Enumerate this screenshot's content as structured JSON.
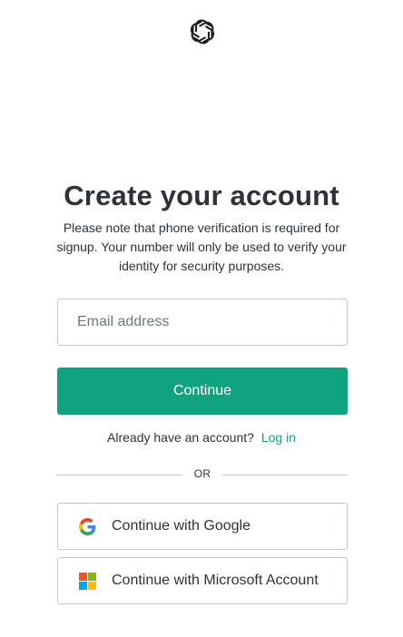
{
  "brand": {
    "logo": "openai-logo-icon"
  },
  "header": {
    "title": "Create your account",
    "subtitle": "Please note that phone verification is required for signup. Your number will only be used to verify your identity for security purposes."
  },
  "form": {
    "email_placeholder": "Email address",
    "email_value": "",
    "continue_label": "Continue"
  },
  "login": {
    "prompt": "Already have an account?",
    "link_label": "Log in"
  },
  "divider": {
    "label": "OR"
  },
  "social": {
    "google_label": "Continue with Google",
    "google_icon": "google-icon",
    "microsoft_label": "Continue with Microsoft Account",
    "microsoft_icon": "microsoft-icon"
  },
  "colors": {
    "accent": "#10a37f",
    "text": "#2d333a",
    "border": "#c2c8d0",
    "ms_red": "#f25022",
    "ms_green": "#7fba00",
    "ms_blue": "#00a4ef",
    "ms_yellow": "#ffb900"
  }
}
